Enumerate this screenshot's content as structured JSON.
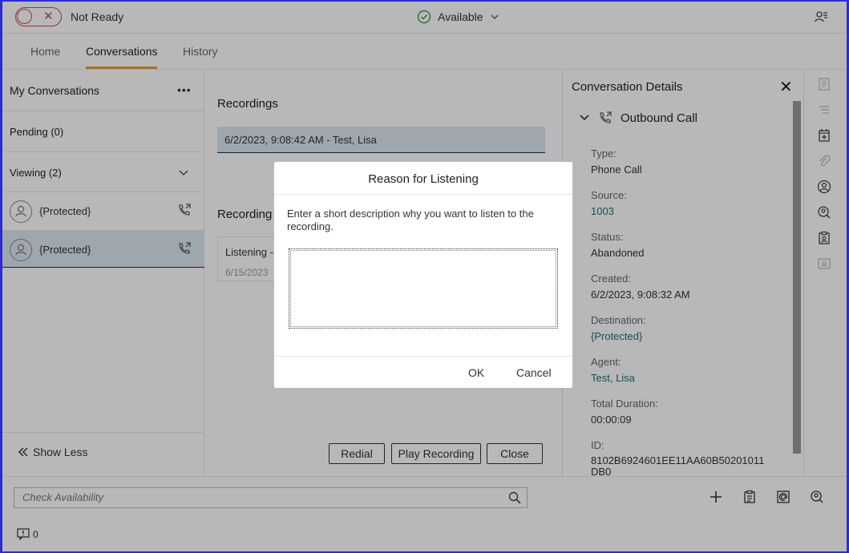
{
  "topbar": {
    "status_label": "Not Ready",
    "availability": "Available"
  },
  "tabs": [
    {
      "label": "Home"
    },
    {
      "label": "Conversations"
    },
    {
      "label": "History"
    }
  ],
  "sidebar": {
    "title": "My Conversations",
    "pending": "Pending (0)",
    "viewing": "Viewing (2)",
    "conversations": [
      {
        "name": "{Protected}"
      },
      {
        "name": "{Protected}"
      }
    ],
    "show_less": "Show Less"
  },
  "main": {
    "recordings_title": "Recordings",
    "recording_row": "6/2/2023, 9:08:42 AM - Test, Lisa",
    "recordings2_title": "Recording",
    "listening_label": "Listening -",
    "listening_date": "6/15/2023",
    "buttons": {
      "redial": "Redial",
      "play": "Play Recording",
      "close": "Close"
    }
  },
  "details": {
    "title": "Conversation Details",
    "call_type": "Outbound Call",
    "fields": [
      {
        "label": "Type:",
        "value": "Phone Call"
      },
      {
        "label": "Source:",
        "value": "1003"
      },
      {
        "label": "Status:",
        "value": "Abandoned"
      },
      {
        "label": "Created:",
        "value": "6/2/2023, 9:08:32 AM"
      },
      {
        "label": "Destination:",
        "value": "{Protected}"
      },
      {
        "label": "Agent:",
        "value": "Test, Lisa"
      },
      {
        "label": "Total Duration:",
        "value": "00:00:09"
      },
      {
        "label": "ID:",
        "value": "8102B6924601EE11AA60B50201011 DB0"
      }
    ]
  },
  "bottom": {
    "search_placeholder": "Check Availability",
    "alert_count": "0"
  },
  "modal": {
    "title": "Reason for Listening",
    "description": "Enter a short description why you want to listen to the recording.",
    "ok": "OK",
    "cancel": "Cancel"
  },
  "colors": {
    "accent": "#e0a13a",
    "not_ready": "#c94b4b",
    "link": "#1d6e7a",
    "selected_row": "#dbe6f1"
  }
}
